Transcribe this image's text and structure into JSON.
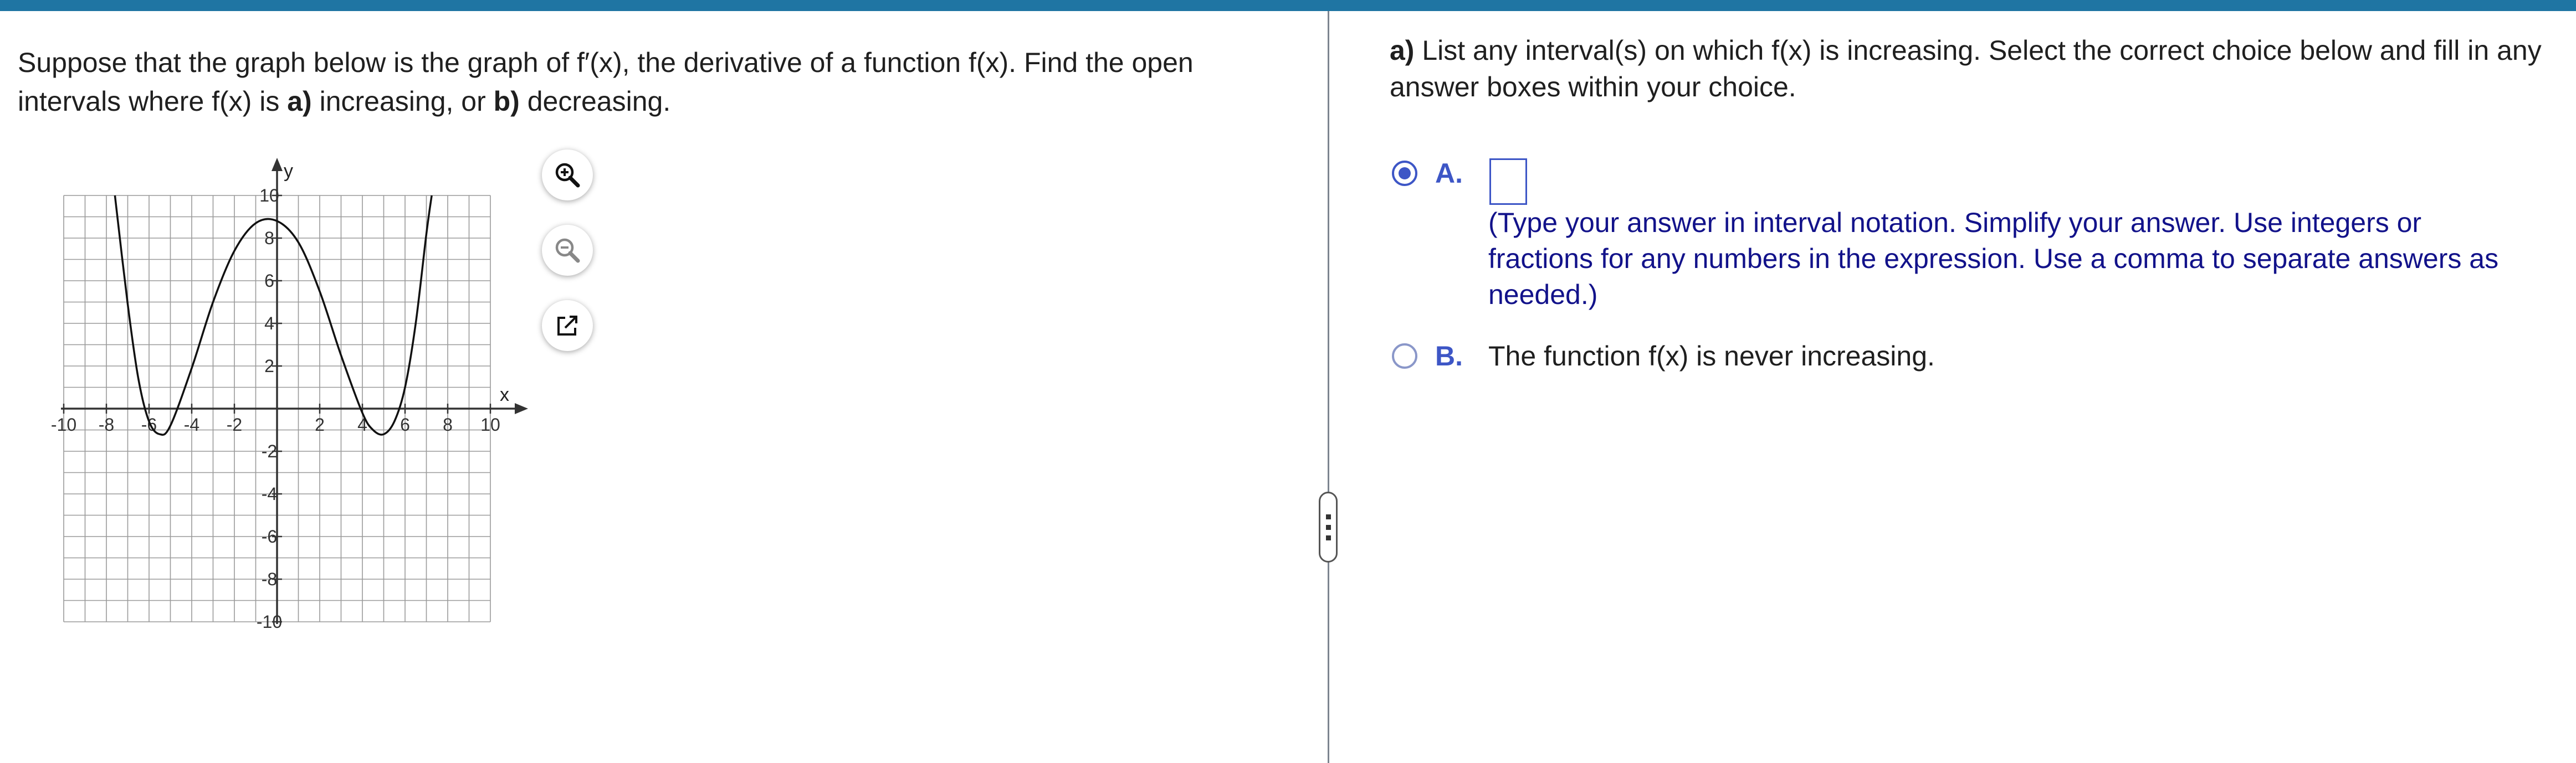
{
  "question": {
    "part1": "Suppose that the graph below is the graph of f′(x), the derivative of a function f(x). Find the open",
    "part2": "intervals where f(x) is ",
    "a_bold": "a)",
    "part3": " increasing, or ",
    "b_bold": "b)",
    "part4": " decreasing."
  },
  "graph": {
    "x_axis_label": "x",
    "y_axis_label": "y",
    "x_ticks": [
      "-10",
      "-8",
      "-6",
      "-4",
      "-2",
      "2",
      "4",
      "6",
      "8",
      "10"
    ],
    "y_ticks": [
      "10",
      "8",
      "6",
      "4",
      "2",
      "-2",
      "-4",
      "-6",
      "-8",
      "-10"
    ],
    "x_range": [
      -10,
      10
    ],
    "y_range": [
      -10,
      10
    ],
    "grid_step": 1,
    "curve_points": [
      {
        "x": -7.6,
        "y": 10
      },
      {
        "x": -7,
        "y": 4.9
      },
      {
        "x": -6.5,
        "y": 1.4
      },
      {
        "x": -6,
        "y": -0.6
      },
      {
        "x": -5.5,
        "y": -1.2
      },
      {
        "x": -5,
        "y": -0.8
      },
      {
        "x": -4,
        "y": 1.9
      },
      {
        "x": -3,
        "y": 5.0
      },
      {
        "x": -2,
        "y": 7.4
      },
      {
        "x": -1,
        "y": 8.7
      },
      {
        "x": 0,
        "y": 8.8
      },
      {
        "x": 1,
        "y": 7.8
      },
      {
        "x": 2,
        "y": 5.5
      },
      {
        "x": 3,
        "y": 2.5
      },
      {
        "x": 4,
        "y": -0.2
      },
      {
        "x": 4.5,
        "y": -1.0
      },
      {
        "x": 5,
        "y": -1.2
      },
      {
        "x": 5.5,
        "y": -0.6
      },
      {
        "x": 6,
        "y": 1.0
      },
      {
        "x": 6.5,
        "y": 4.0
      },
      {
        "x": 7,
        "y": 8.2
      },
      {
        "x": 7.25,
        "y": 10
      }
    ]
  },
  "tools": {
    "zoom_in": "zoom-in-icon",
    "zoom_out": "zoom-out-icon",
    "popout": "external-link-icon"
  },
  "prompt": {
    "a_bold": "a)",
    "text": " List any interval(s) on which f(x) is increasing. Select the correct choice below and fill in any answer boxes within your choice."
  },
  "choices": {
    "a": {
      "letter": "A.",
      "selected": true,
      "input_value": "",
      "hint": "(Type your answer in interval notation. Simplify your answer. Use integers or fractions for any numbers in the expression. Use a comma to separate answers as needed.)"
    },
    "b": {
      "letter": "B.",
      "selected": false,
      "text": "The function f(x) is never increasing."
    }
  },
  "colors": {
    "top_bar": "#1f75a3",
    "accent": "#3d56c6",
    "hint_text": "#12128a"
  }
}
